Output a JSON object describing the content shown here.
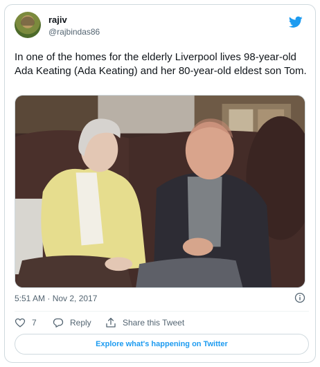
{
  "user": {
    "name": "rajiv",
    "handle": "@rajbindas86"
  },
  "tweet": {
    "text": "In one of the homes for the elderly Liverpool lives 98-year-old Ada Keating (Ada Keating) and her 80-year-old eldest son Tom.",
    "timestamp": "5:51 AM · Nov 2, 2017"
  },
  "actions": {
    "like_count": "7",
    "reply_label": "Reply",
    "share_label": "Share this Tweet"
  },
  "explore_label": "Explore what's happening on Twitter",
  "colors": {
    "accent": "#1d9bf0",
    "secondary_text": "#536471",
    "border": "#cfd9de"
  },
  "icons": [
    "twitter-bird-icon",
    "info-icon",
    "heart-icon",
    "reply-icon",
    "share-icon"
  ]
}
